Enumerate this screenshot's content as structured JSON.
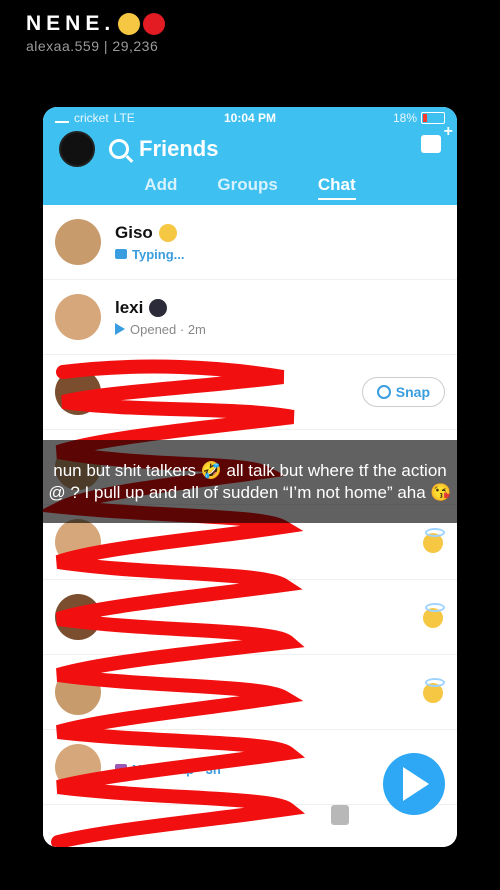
{
  "story": {
    "title": "NENE.",
    "username": "alexaa.559 | 29,236"
  },
  "status": {
    "carrier": "cricket",
    "network": "LTE",
    "time": "10:04 PM",
    "battery": "18%"
  },
  "header": {
    "search_label": "Friends"
  },
  "tabs": [
    {
      "label": "Add"
    },
    {
      "label": "Groups"
    },
    {
      "label": "Chat"
    }
  ],
  "chats": [
    {
      "name": "Giso",
      "status": "Typing..."
    },
    {
      "name": "lexi",
      "status": "Opened · 2m"
    },
    {
      "name": "",
      "status": "",
      "action": "Snap"
    },
    {
      "name": "",
      "status": ""
    },
    {
      "name": "",
      "status": ""
    },
    {
      "name": "",
      "status": ""
    },
    {
      "name": "",
      "status": ""
    },
    {
      "name": "",
      "status": "New Snap · 3h"
    }
  ],
  "caption": "nun but shit talkers 🤣 all talk but where tf the action @ ? I pull up and all of sudden “I’m not home” aha 😘",
  "colors": {
    "accent": "#3EC0F0",
    "scribble": "#F20F0F",
    "send": "#2EA8F4"
  }
}
